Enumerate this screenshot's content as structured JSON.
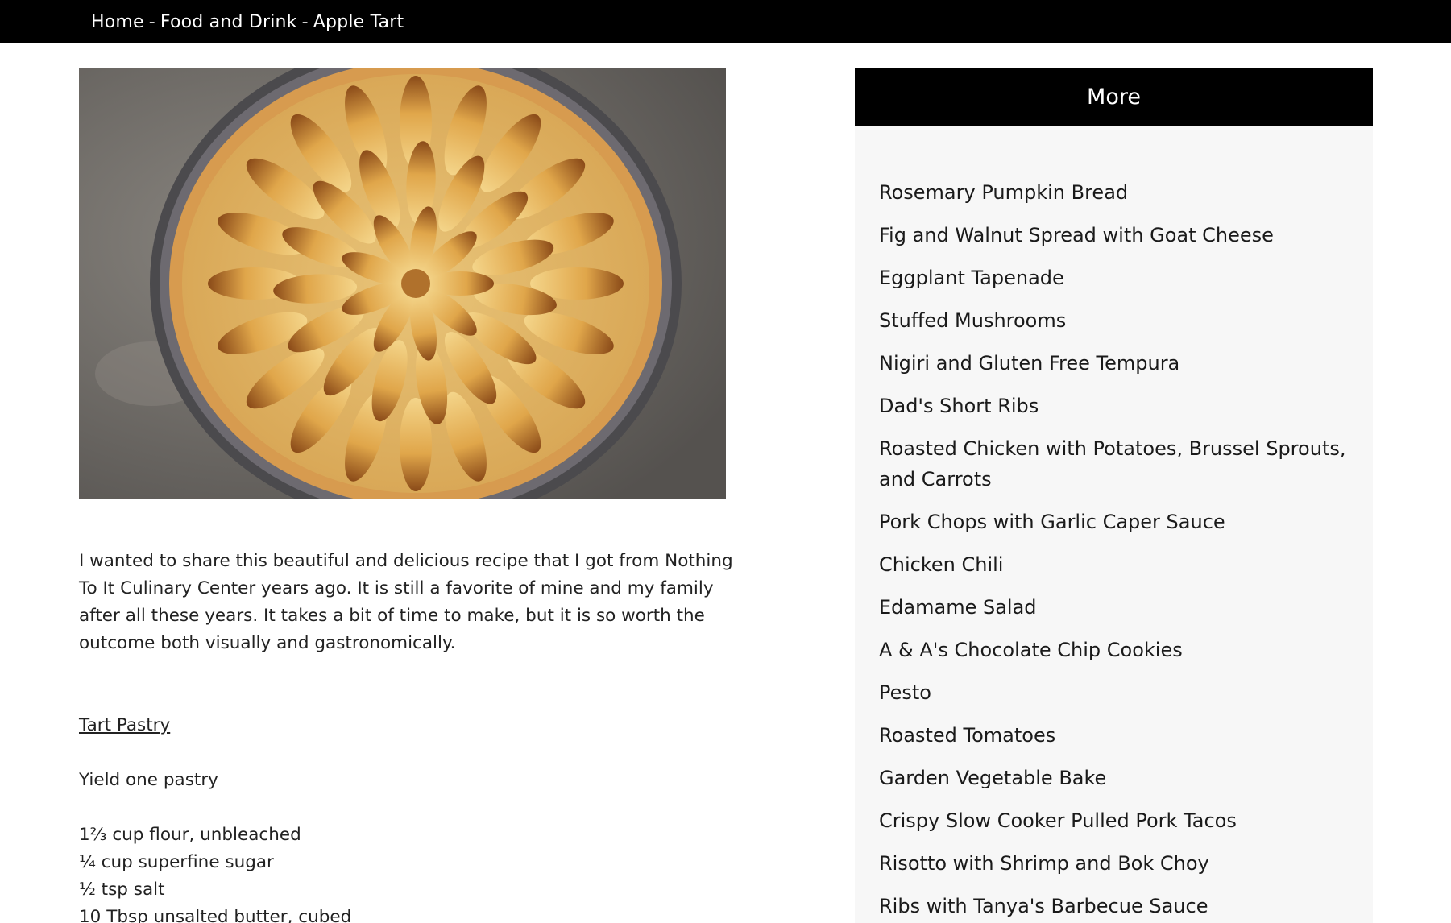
{
  "breadcrumb": {
    "home": "Home",
    "separator": "-",
    "category": "Food and Drink",
    "current": "Apple Tart"
  },
  "hero": {
    "image_label": "apple-tart-photo"
  },
  "article": {
    "intro": "I wanted to share this beautiful and delicious recipe that I got from Nothing To It Culinary Center years ago. It is still a favorite of mine and my family after all these years. It takes a bit of time to make, but it is so worth the outcome both visually and gastronomically.",
    "section_title": "Tart Pastry ",
    "yield": "Yield one pastry",
    "ingredients": [
      "1⅔ cup flour, unbleached",
      "¼ cup superfine sugar",
      "½ tsp salt",
      "10 Tbsp unsalted butter, cubed"
    ]
  },
  "sidebar": {
    "title": "More",
    "items": [
      "Rosemary Pumpkin Bread",
      "Fig and Walnut Spread with Goat Cheese",
      "Eggplant Tapenade",
      "Stuffed Mushrooms",
      "Nigiri and Gluten Free Tempura",
      "Dad's Short Ribs",
      "Roasted Chicken with Potatoes, Brussel Sprouts, and Carrots",
      "Pork Chops with Garlic Caper Sauce",
      "Chicken Chili",
      "Edamame Salad",
      "A & A's Chocolate Chip Cookies",
      "Pesto",
      "Roasted Tomatoes",
      "Garden Vegetable Bake",
      "Crispy Slow Cooker Pulled Pork Tacos",
      "Risotto with Shrimp and Bok Choy",
      "Ribs with Tanya's Barbecue Sauce"
    ]
  },
  "colors": {
    "topbar_bg": "#000000",
    "sidebar_bg": "#f7f7f7",
    "sidebar_header_bg": "#000000"
  }
}
